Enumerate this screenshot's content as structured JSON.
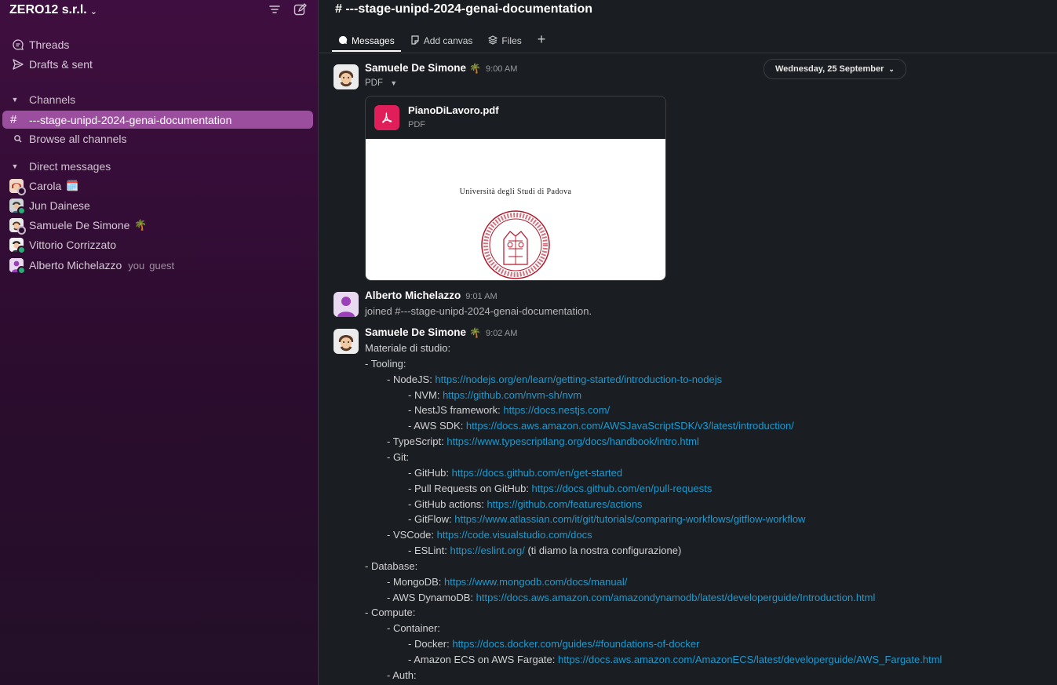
{
  "workspace": {
    "name": "ZERO12 s.r.l."
  },
  "sidebar": {
    "nav": [
      {
        "label": "Threads",
        "icon": "threads-icon"
      },
      {
        "label": "Drafts & sent",
        "icon": "send-icon"
      }
    ],
    "channels_section": "Channels",
    "active_channel": "---stage-unipd-2024-genai-documentation",
    "browse_channels": "Browse all channels",
    "dm_section": "Direct messages",
    "dms": [
      {
        "name": "Carola",
        "emoji": "🗓️"
      },
      {
        "name": "Jun Dainese",
        "emoji": ""
      },
      {
        "name": "Samuele De Simone",
        "emoji": "🌴"
      },
      {
        "name": "Vittorio Corrizzato",
        "emoji": ""
      },
      {
        "name": "Alberto Michelazzo",
        "you": "you",
        "guest": "guest"
      }
    ]
  },
  "header": {
    "channel_title": "# ---stage-unipd-2024-genai-documentation",
    "tabs": [
      "Messages",
      "Add canvas",
      "Files"
    ],
    "add_tab": "+"
  },
  "date_divider": "Wednesday, 25 September",
  "messages": [
    {
      "author": "Samuele De Simone",
      "emoji": "🌴",
      "time": "9:00 AM",
      "file_label": "PDF",
      "file": {
        "name": "PianoDiLavoro.pdf",
        "type": "PDF",
        "preview_heading": "Università degli Studi di Padova"
      }
    },
    {
      "author": "Alberto Michelazzo",
      "time": "9:01 AM",
      "text": "joined #---stage-unipd-2024-genai-documentation."
    },
    {
      "author": "Samuele De Simone",
      "emoji": "🌴",
      "time": "9:02 AM",
      "lines": [
        {
          "text": "Materiale di studio:",
          "link": "",
          "suffix": "",
          "indent": 0
        },
        {
          "text": "- Tooling:",
          "link": "",
          "suffix": "",
          "indent": 0
        },
        {
          "text": "- NodeJS: ",
          "link": "https://nodejs.org/en/learn/getting-started/introduction-to-nodejs",
          "suffix": "",
          "indent": 1
        },
        {
          "text": "- NVM: ",
          "link": "https://github.com/nvm-sh/nvm",
          "suffix": "",
          "indent": 2
        },
        {
          "text": "- NestJS framework: ",
          "link": "https://docs.nestjs.com/",
          "suffix": "",
          "indent": 2
        },
        {
          "text": "- AWS SDK: ",
          "link": "https://docs.aws.amazon.com/AWSJavaScriptSDK/v3/latest/introduction/",
          "suffix": "",
          "indent": 2
        },
        {
          "text": "- TypeScript: ",
          "link": "https://www.typescriptlang.org/docs/handbook/intro.html",
          "suffix": "",
          "indent": 1
        },
        {
          "text": "- Git:",
          "link": "",
          "suffix": "",
          "indent": 1
        },
        {
          "text": "- GitHub: ",
          "link": "https://docs.github.com/en/get-started",
          "suffix": "",
          "indent": 2
        },
        {
          "text": "- Pull Requests on GitHub: ",
          "link": "https://docs.github.com/en/pull-requests",
          "suffix": "",
          "indent": 2
        },
        {
          "text": "- GitHub actions: ",
          "link": "https://github.com/features/actions",
          "suffix": "",
          "indent": 2
        },
        {
          "text": "- GitFlow: ",
          "link": "https://www.atlassian.com/it/git/tutorials/comparing-workflows/gitflow-workflow",
          "suffix": "",
          "indent": 2
        },
        {
          "text": "- VSCode: ",
          "link": "https://code.visualstudio.com/docs",
          "suffix": "",
          "indent": 1
        },
        {
          "text": "- ESLint: ",
          "link": "https://eslint.org/",
          "suffix": " (ti diamo la nostra configurazione)",
          "indent": 2
        },
        {
          "text": "- Database:",
          "link": "",
          "suffix": "",
          "indent": 0
        },
        {
          "text": "- MongoDB: ",
          "link": "https://www.mongodb.com/docs/manual/",
          "suffix": "",
          "indent": 1
        },
        {
          "text": "- AWS DynamoDB: ",
          "link": "https://docs.aws.amazon.com/amazondynamodb/latest/developerguide/Introduction.html",
          "suffix": "",
          "indent": 1
        },
        {
          "text": "- Compute:",
          "link": "",
          "suffix": "",
          "indent": 0
        },
        {
          "text": "- Container:",
          "link": "",
          "suffix": "",
          "indent": 1
        },
        {
          "text": "- Docker: ",
          "link": "https://docs.docker.com/guides/#foundations-of-docker",
          "suffix": "",
          "indent": 2
        },
        {
          "text": "- Amazon ECS on AWS Fargate: ",
          "link": "https://docs.aws.amazon.com/AmazonECS/latest/developerguide/AWS_Fargate.html",
          "suffix": "",
          "indent": 2
        },
        {
          "text": "- Auth:",
          "link": "",
          "suffix": "",
          "indent": 1
        }
      ]
    }
  ],
  "colors": {
    "sidebar_bg": "#3f0e40",
    "active_channel_bg": "#9b4e9e",
    "link": "#1d9bd1",
    "main_bg": "#1a1d21",
    "pdf_icon_bg": "#e01e5a",
    "seal": "#b0182b"
  }
}
